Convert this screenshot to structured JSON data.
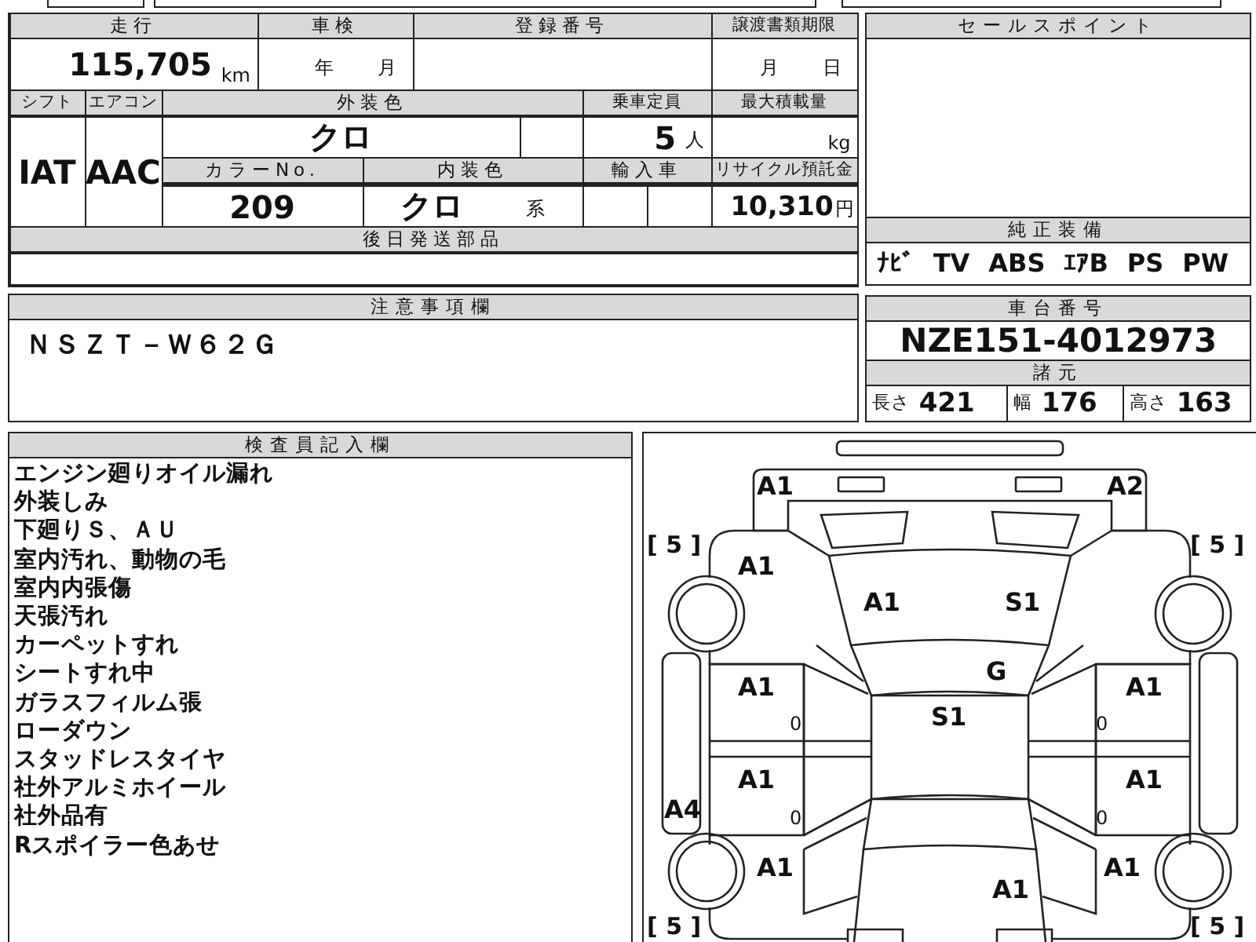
{
  "vehicle_info": {
    "mileage": {
      "label": "走行",
      "value": "115,705",
      "unit": "km"
    },
    "inspection": {
      "label": "車検",
      "year_unit": "年",
      "month_unit": "月"
    },
    "registration_number": {
      "label": "登録番号"
    },
    "transfer_deadline": {
      "label": "譲渡書類期限",
      "month_unit": "月",
      "day_unit": "日"
    },
    "shift": {
      "label": "シフト",
      "value": "IAT"
    },
    "air_conditioner": {
      "label": "エアコン",
      "value": "AAC"
    },
    "exterior_color": {
      "label": "外装色",
      "value": "クロ"
    },
    "capacity": {
      "label": "乗車定員",
      "value": "5",
      "unit": "人"
    },
    "max_load": {
      "label": "最大積載量",
      "unit": "kg"
    },
    "color_number": {
      "label": "カラーNo.",
      "value": "209"
    },
    "interior_color": {
      "label": "内装色",
      "value": "クロ",
      "suffix": "系"
    },
    "imported": {
      "label": "輸入車"
    },
    "recycle_fee": {
      "label": "リサイクル預託金",
      "value": "10,310",
      "unit": "円"
    },
    "later_parts": {
      "label": "後日発送部品"
    }
  },
  "notes": {
    "label": "注意事項欄",
    "text": "ＮＳＺＴ－Ｗ６２Ｇ"
  },
  "sales_points": {
    "label": "セールスポイント"
  },
  "standard_equipment": {
    "label": "純正装備",
    "items": [
      "ﾅﾋﾞ",
      "TV",
      "ABS",
      "ｴｱB",
      "PS",
      "PW"
    ]
  },
  "chassis": {
    "label": "車台番号",
    "value": "NZE151-4012973"
  },
  "specs": {
    "label": "諸元",
    "items": [
      {
        "label": "長さ",
        "value": "421"
      },
      {
        "label": "幅",
        "value": "176"
      },
      {
        "label": "高さ",
        "value": "163"
      }
    ]
  },
  "inspector_notes": {
    "label": "検査員記入欄",
    "lines": [
      "エンジン廻りオイル漏れ",
      "外装しみ",
      "下廻りＳ、ＡＵ",
      "室内汚れ、動物の毛",
      "室内内張傷",
      "天張汚れ",
      "カーペットすれ",
      "シートすれ中",
      "ガラスフィルム張",
      "ローダウン",
      "スタッドレスタイヤ",
      "社外アルミホイール",
      "社外品有",
      "Rスポイラー色あせ"
    ]
  },
  "condition_diagram": {
    "marks": {
      "front_bumper_left": "A1",
      "front_bumper_right": "A2",
      "front_fender_left": "A1",
      "hood_left": "A1",
      "hood_right": "S1",
      "windshield": "G",
      "roof": "S1",
      "front_door_left": "A1",
      "front_door_left_note": "0",
      "front_door_right": "A1",
      "front_door_right_note": "0",
      "rear_door_left": "A1",
      "rear_door_left_note": "0",
      "rear_door_right": "A1",
      "rear_door_right_note": "0",
      "side_skirt_left": "A4",
      "rear_fender_left": "A1",
      "rear_fender_right": "A1",
      "trunk": "A1"
    },
    "tire_treads": {
      "front_left": "[ 5 ]",
      "front_right": "[ 5 ]",
      "rear_left": "[ 5 ]",
      "rear_right": "[ 5 ]"
    }
  }
}
